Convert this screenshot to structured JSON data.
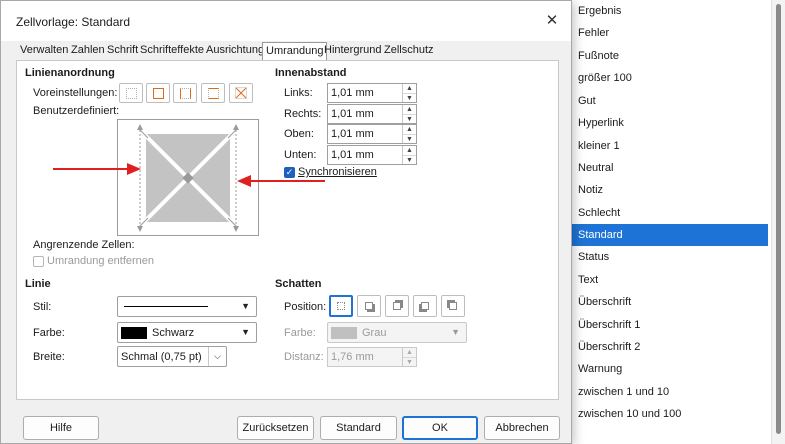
{
  "dialog": {
    "title": "Zellvorlage: Standard",
    "close_icon": "close-icon"
  },
  "tabs": [
    {
      "label": "Verwalten"
    },
    {
      "label": "Zahlen"
    },
    {
      "label": "Schrift"
    },
    {
      "label": "Schrifteffekte"
    },
    {
      "label": "Ausrichtung"
    },
    {
      "label": "Umrandung",
      "active": true
    },
    {
      "label": "Hintergrund"
    },
    {
      "label": "Zellschutz"
    }
  ],
  "line_arrangement": {
    "title": "Linienanordnung",
    "presets_label": "Voreinstellungen:",
    "presets": [
      {
        "icon": "no-borders-icon"
      },
      {
        "icon": "outer-border-icon"
      },
      {
        "icon": "left-right-borders-icon"
      },
      {
        "icon": "top-bottom-borders-icon"
      },
      {
        "icon": "diagonal-borders-icon"
      }
    ],
    "user_defined_label": "Benutzerdefiniert:",
    "adjacent_cells_label": "Angrenzende Zellen:",
    "remove_border_label": "Umrandung entfernen"
  },
  "padding": {
    "title": "Innenabstand",
    "fields": [
      {
        "label": "Links:",
        "value": "1,01 mm"
      },
      {
        "label": "Rechts:",
        "value": "1,01 mm"
      },
      {
        "label": "Oben:",
        "value": "1,01 mm"
      },
      {
        "label": "Unten:",
        "value": "1,01 mm"
      }
    ],
    "sync_label": "Synchronisieren",
    "sync_checked": true
  },
  "line": {
    "title": "Linie",
    "style_label": "Stil:",
    "color_label": "Farbe:",
    "color_value": "Schwarz",
    "color_swatch": "#000000",
    "width_label": "Breite:",
    "width_value": "Schmal (0,75 pt)"
  },
  "shadow": {
    "title": "Schatten",
    "position_label": "Position:",
    "color_label": "Farbe:",
    "color_value": "Grau",
    "color_swatch": "#c0c0c0",
    "distance_label": "Distanz:",
    "distance_value": "1,76 mm"
  },
  "buttons": {
    "help": "Hilfe",
    "reset": "Zurücksetzen",
    "standard": "Standard",
    "ok": "OK",
    "cancel": "Abbrechen"
  },
  "style_list": [
    "Ergebnis",
    "Fehler",
    "Fußnote",
    "größer 100",
    "Gut",
    "Hyperlink",
    "kleiner 1",
    "Neutral",
    "Notiz",
    "Schlecht",
    "Standard",
    "Status",
    "Text",
    "Überschrift",
    "Überschrift 1",
    "Überschrift 2",
    "Warnung",
    "zwischen 1 und 10",
    "zwischen 10 und 100"
  ],
  "selected_style": "Standard",
  "colors": {
    "accent": "#1e73d6",
    "annotation_arrow": "#e02020"
  }
}
